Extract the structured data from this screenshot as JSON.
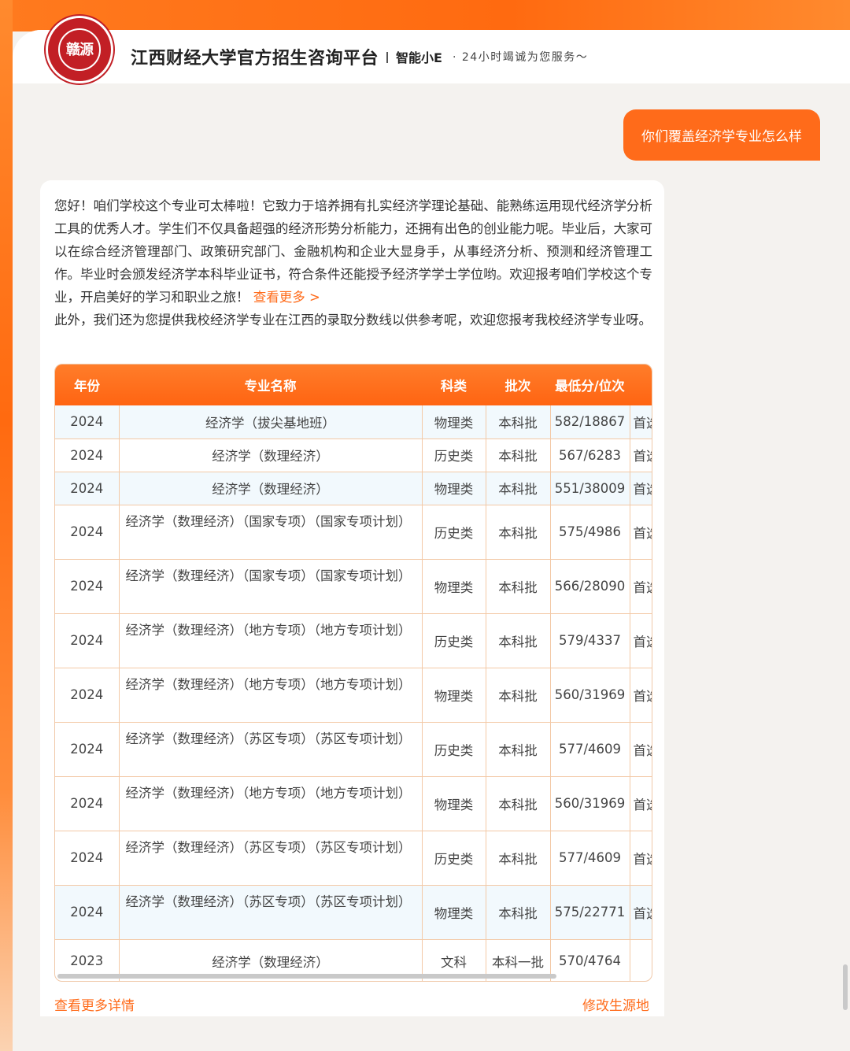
{
  "header": {
    "logo_text": "江西财经大学",
    "seal_chars": "赣源",
    "title": "江西财经大学官方招生咨询平台",
    "brand": "智能小E",
    "slogan": "· 24小时竭诚为您服务～"
  },
  "conversation": {
    "user_message": "你们覆盖经济学专业怎么样",
    "reply_paragraph": "您好！咱们学校这个专业可太棒啦！它致力于培养拥有扎实经济学理论基础、能熟练运用现代经济学分析工具的优秀人才。学生们不仅具备超强的经济形势分析能力，还拥有出色的创业能力呢。毕业后，大家可以在综合经济管理部门、政策研究部门、金融机构和企业大显身手，从事经济分析、预测和经济管理工作。毕业时会颁发经济学本科毕业证书，符合条件还能授予经济学学士学位哟。欢迎报考咱们学校这个专业，开启美好的学习和职业之旅！",
    "see_more": "查看更多 >",
    "reply_paragraph_2": "此外，我们还为您提供我校经济学专业在江西的录取分数线以供参考呢，欢迎您报考我校经济学专业呀。"
  },
  "table": {
    "headers": [
      "年份",
      "专业名称",
      "科类",
      "批次",
      "最低分/位次",
      ""
    ],
    "rows": [
      {
        "year": "2024",
        "name": "经济学（拔尖基地班）",
        "category": "物理类",
        "batch": "本科批",
        "score": "582/18867",
        "extra": "首选"
      },
      {
        "year": "2024",
        "name": "经济学（数理经济）",
        "category": "历史类",
        "batch": "本科批",
        "score": "567/6283",
        "extra": "首选"
      },
      {
        "year": "2024",
        "name": "经济学（数理经济）",
        "category": "物理类",
        "batch": "本科批",
        "score": "551/38009",
        "extra": "首选"
      },
      {
        "year": "2024",
        "name": "经济学（数理经济）（国家专项）（国家专项计划）",
        "category": "历史类",
        "batch": "本科批",
        "score": "575/4986",
        "extra": "首选"
      },
      {
        "year": "2024",
        "name": "经济学（数理经济）（国家专项）（国家专项计划）",
        "category": "物理类",
        "batch": "本科批",
        "score": "566/28090",
        "extra": "首选"
      },
      {
        "year": "2024",
        "name": "经济学（数理经济）（地方专项）（地方专项计划）",
        "category": "历史类",
        "batch": "本科批",
        "score": "579/4337",
        "extra": "首选"
      },
      {
        "year": "2024",
        "name": "经济学（数理经济）（地方专项）（地方专项计划）",
        "category": "物理类",
        "batch": "本科批",
        "score": "560/31969",
        "extra": "首选"
      },
      {
        "year": "2024",
        "name": "经济学（数理经济）（苏区专项）（苏区专项计划）",
        "category": "历史类",
        "batch": "本科批",
        "score": "577/4609",
        "extra": "首选"
      },
      {
        "year": "2024",
        "name": "经济学（数理经济）（地方专项）（地方专项计划）",
        "category": "物理类",
        "batch": "本科批",
        "score": "560/31969",
        "extra": "首选"
      },
      {
        "year": "2024",
        "name": "经济学（数理经济）（苏区专项）（苏区专项计划）",
        "category": "历史类",
        "batch": "本科批",
        "score": "577/4609",
        "extra": "首选"
      },
      {
        "year": "2024",
        "name": "经济学（数理经济）（苏区专项）（苏区专项计划）",
        "category": "物理类",
        "batch": "本科批",
        "score": "575/22771",
        "extra": "首选"
      },
      {
        "year": "2023",
        "name": "经济学（数理经济）",
        "category": "文科",
        "batch": "本科一批",
        "score": "570/4764",
        "extra": ""
      }
    ]
  },
  "footer": {
    "view_details": "查看更多详情",
    "change_origin": "修改生源地"
  },
  "colors": {
    "accent": "#ff6b1a",
    "header_gradient_start": "#ff7d2a",
    "header_gradient_end": "#ff6412",
    "row_highlight": "#f2f9fd",
    "table_border": "#f3c9a6",
    "logo_red": "#c21f25"
  }
}
